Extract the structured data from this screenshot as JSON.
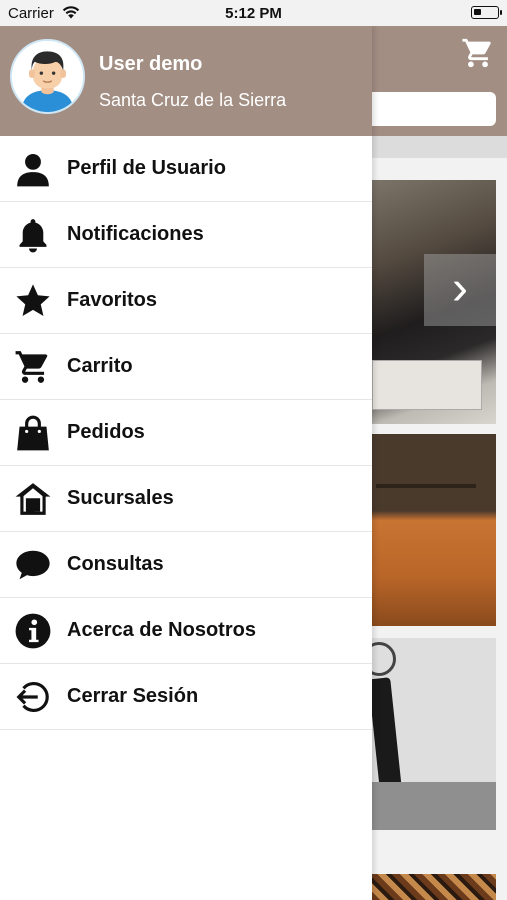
{
  "status_bar": {
    "carrier": "Carrier",
    "time": "5:12 PM"
  },
  "drawer": {
    "user_name": "User demo",
    "user_city": "Santa Cruz de la Sierra",
    "header_color": "#a28e83",
    "items": [
      {
        "label": "Perfil de Usuario",
        "icon": "user-icon"
      },
      {
        "label": "Notificaciones",
        "icon": "bell-icon"
      },
      {
        "label": "Favoritos",
        "icon": "star-icon"
      },
      {
        "label": "Carrito",
        "icon": "cart-icon"
      },
      {
        "label": "Pedidos",
        "icon": "shopping-bag-icon"
      },
      {
        "label": "Sucursales",
        "icon": "store-house-icon"
      },
      {
        "label": "Consultas",
        "icon": "chat-bubble-icon"
      },
      {
        "label": "Acerca de Nosotros",
        "icon": "info-icon"
      },
      {
        "label": "Cerrar Sesión",
        "icon": "logout-icon"
      }
    ]
  },
  "background_app": {
    "cart_icon": "cart-icon",
    "search_placeholder": ""
  }
}
